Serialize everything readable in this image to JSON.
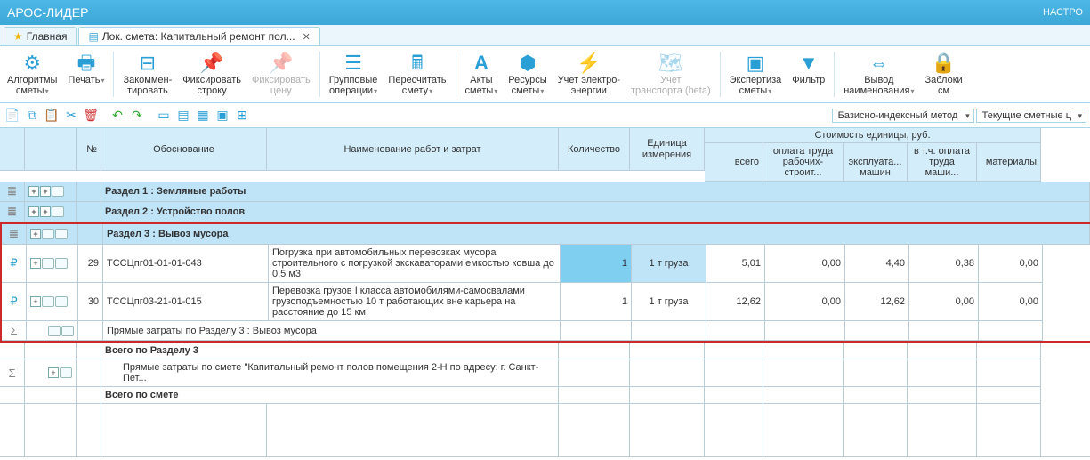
{
  "app": {
    "title": "АРОС-ЛИДЕР",
    "settings": "НАСТРО"
  },
  "tabs": {
    "home": "Главная",
    "doc": "Лок. смета: Капитальный ремонт пол..."
  },
  "ribbon": {
    "algo": "Алгоритмы\nсметы",
    "print": "Печать",
    "comment": "Закоммен-\nтировать",
    "fixrow": "Фиксировать\nстроку",
    "fixprice": "Фиксировать\nцену",
    "group": "Групповые\nоперации",
    "recalc": "Пересчитать\nсмету",
    "acts": "Акты\nсметы",
    "res": "Ресурсы\nсметы",
    "energy": "Учет электро-\nэнергии",
    "transport": "Учет\nтранспорта (beta)",
    "expert": "Экспертиза\nсметы",
    "filter": "Фильтр",
    "output": "Вывод\nнаименования",
    "block": "Заблоки\nсм"
  },
  "method": "Базисно-индексный метод",
  "prices": "Текущие сметные ц",
  "headers": {
    "num": "№",
    "ob": "Обоснование",
    "name": "Наименование работ и затрат",
    "qty": "Количество",
    "unit": "Единица\nизмерения",
    "cost": "Стоимость единицы, руб.",
    "all": "всего",
    "lab": "оплата труда\nрабочих-строит...",
    "mach": "эксплуата...\nмашин",
    "inc": "в т.ч. оплата\nтруда маши...",
    "mat": "материалы"
  },
  "sections": {
    "s1": "Раздел 1 : Земляные работы",
    "s2": "Раздел 2 : Устройство полов",
    "s3": "Раздел 3 : Вывоз мусора"
  },
  "rows": [
    {
      "n": "29",
      "ob": "ТССЦпг01-01-01-043",
      "nm": "Погрузка при автомобильных перевозках мусора строительного с погрузкой экскаваторами емкостью ковша до 0,5 м3",
      "qty": "1",
      "un": "1 т груза",
      "v1": "5,01",
      "v2": "0,00",
      "v3": "4,40",
      "v4": "0,38",
      "v5": "0,00"
    },
    {
      "n": "30",
      "ob": "ТССЦпг03-21-01-015",
      "nm": "Перевозка грузов I класса автомобилями-самосвалами грузоподъемностью 10 т работающих вне карьера на расстояние до 15 км",
      "qty": "1",
      "un": "1 т груза",
      "v1": "12,62",
      "v2": "0,00",
      "v3": "12,62",
      "v4": "0,00",
      "v5": "0,00"
    }
  ],
  "sub3": "Прямые затраты по Разделу 3 : Вывоз мусора",
  "tot3": "Всего по Разделу 3",
  "subAll": "Прямые затраты по смете \"Капитальный ремонт полов помещения 2-Н по адресу: г. Санкт-Пет...",
  "totAll": "Всего по смете"
}
